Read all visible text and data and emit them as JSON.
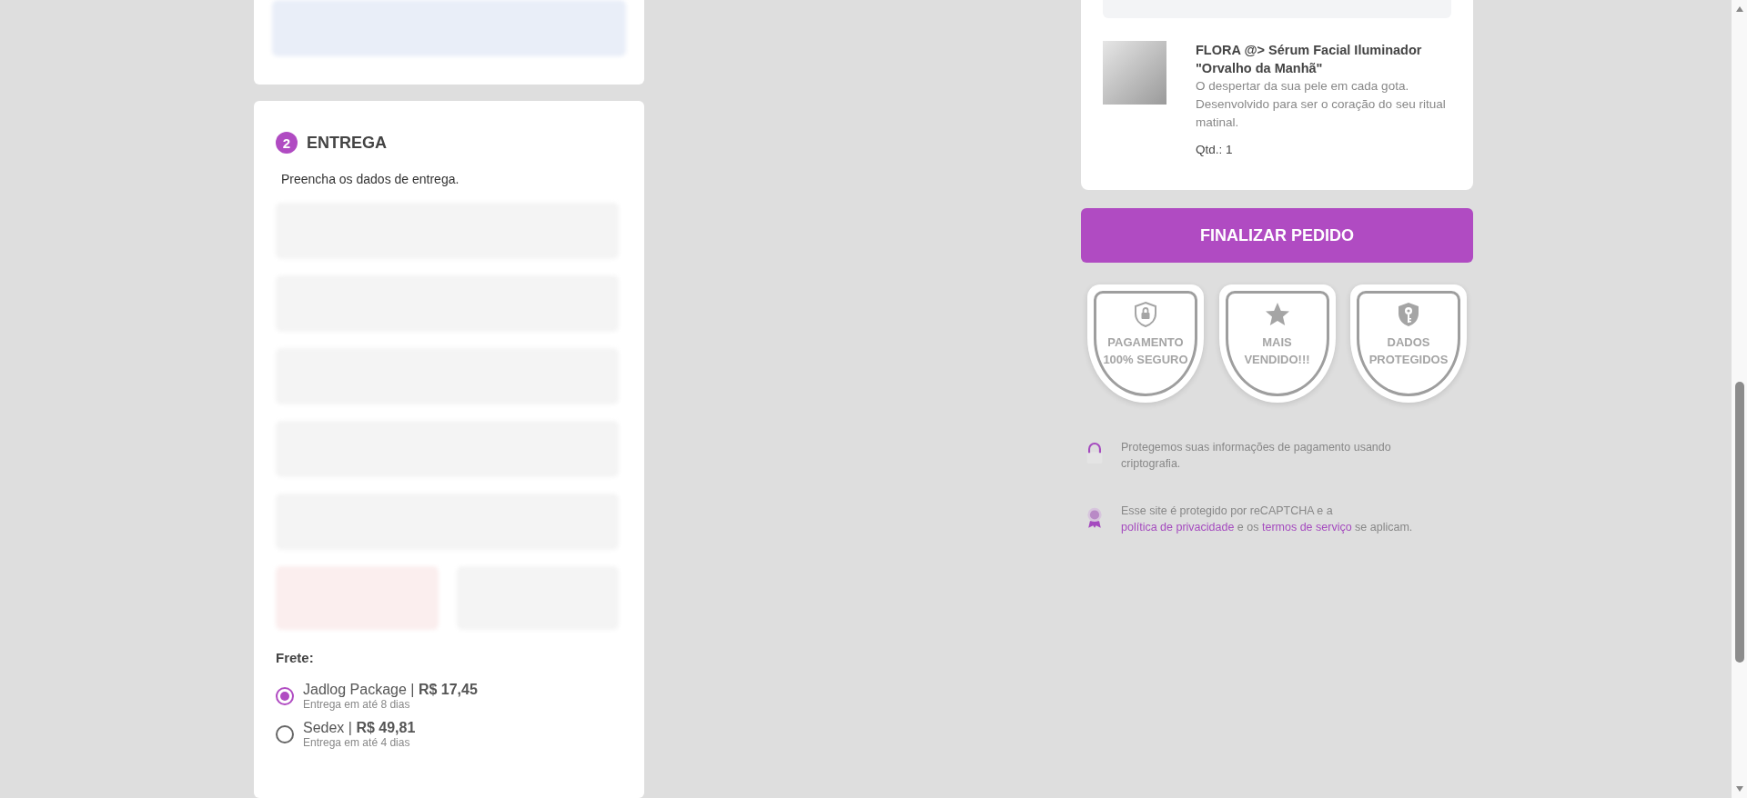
{
  "delivery": {
    "step": "2",
    "title": "ENTREGA",
    "subtitle": "Preencha os dados de entrega.",
    "shipping_label": "Frete:",
    "shipping_options": [
      {
        "label": "Jadlog Package | **R$ 17,45**",
        "eta": "Entrega em até 8 dias",
        "selected": true
      },
      {
        "label": "Sedex | **R$ 49,81**",
        "eta": "Entrega em até 4 dias",
        "selected": false
      }
    ]
  },
  "order_item": {
    "title": "FLORA @> Sérum Facial Iluminador \"Orvalho da Manhã\"",
    "description": "O despertar da sua pele em cada gota. Desenvolvido para ser o coração do seu ritual matinal.",
    "quantity": "Qtd.: 1"
  },
  "checkout_button": "FINALIZAR PEDIDO",
  "badges": [
    {
      "kind": "lock",
      "label": "PAGAMENTO 100% SEGURO"
    },
    {
      "kind": "star",
      "label": "MAIS VENDIDO!!!"
    },
    {
      "kind": "key",
      "label": "DADOS PROTEGIDOS"
    }
  ],
  "notices": [
    {
      "kind": "lock",
      "parts": [
        {
          "text": "Protegemos suas informações de pagamento usando criptografia."
        }
      ]
    },
    {
      "kind": "seal",
      "parts": [
        {
          "text": "Esse site é protegido por reCAPTCHA e a "
        },
        {
          "link": "política de privacidade"
        },
        {
          "text": " e os "
        },
        {
          "link": "termos de serviço"
        },
        {
          "text": " se aplicam."
        }
      ]
    }
  ]
}
